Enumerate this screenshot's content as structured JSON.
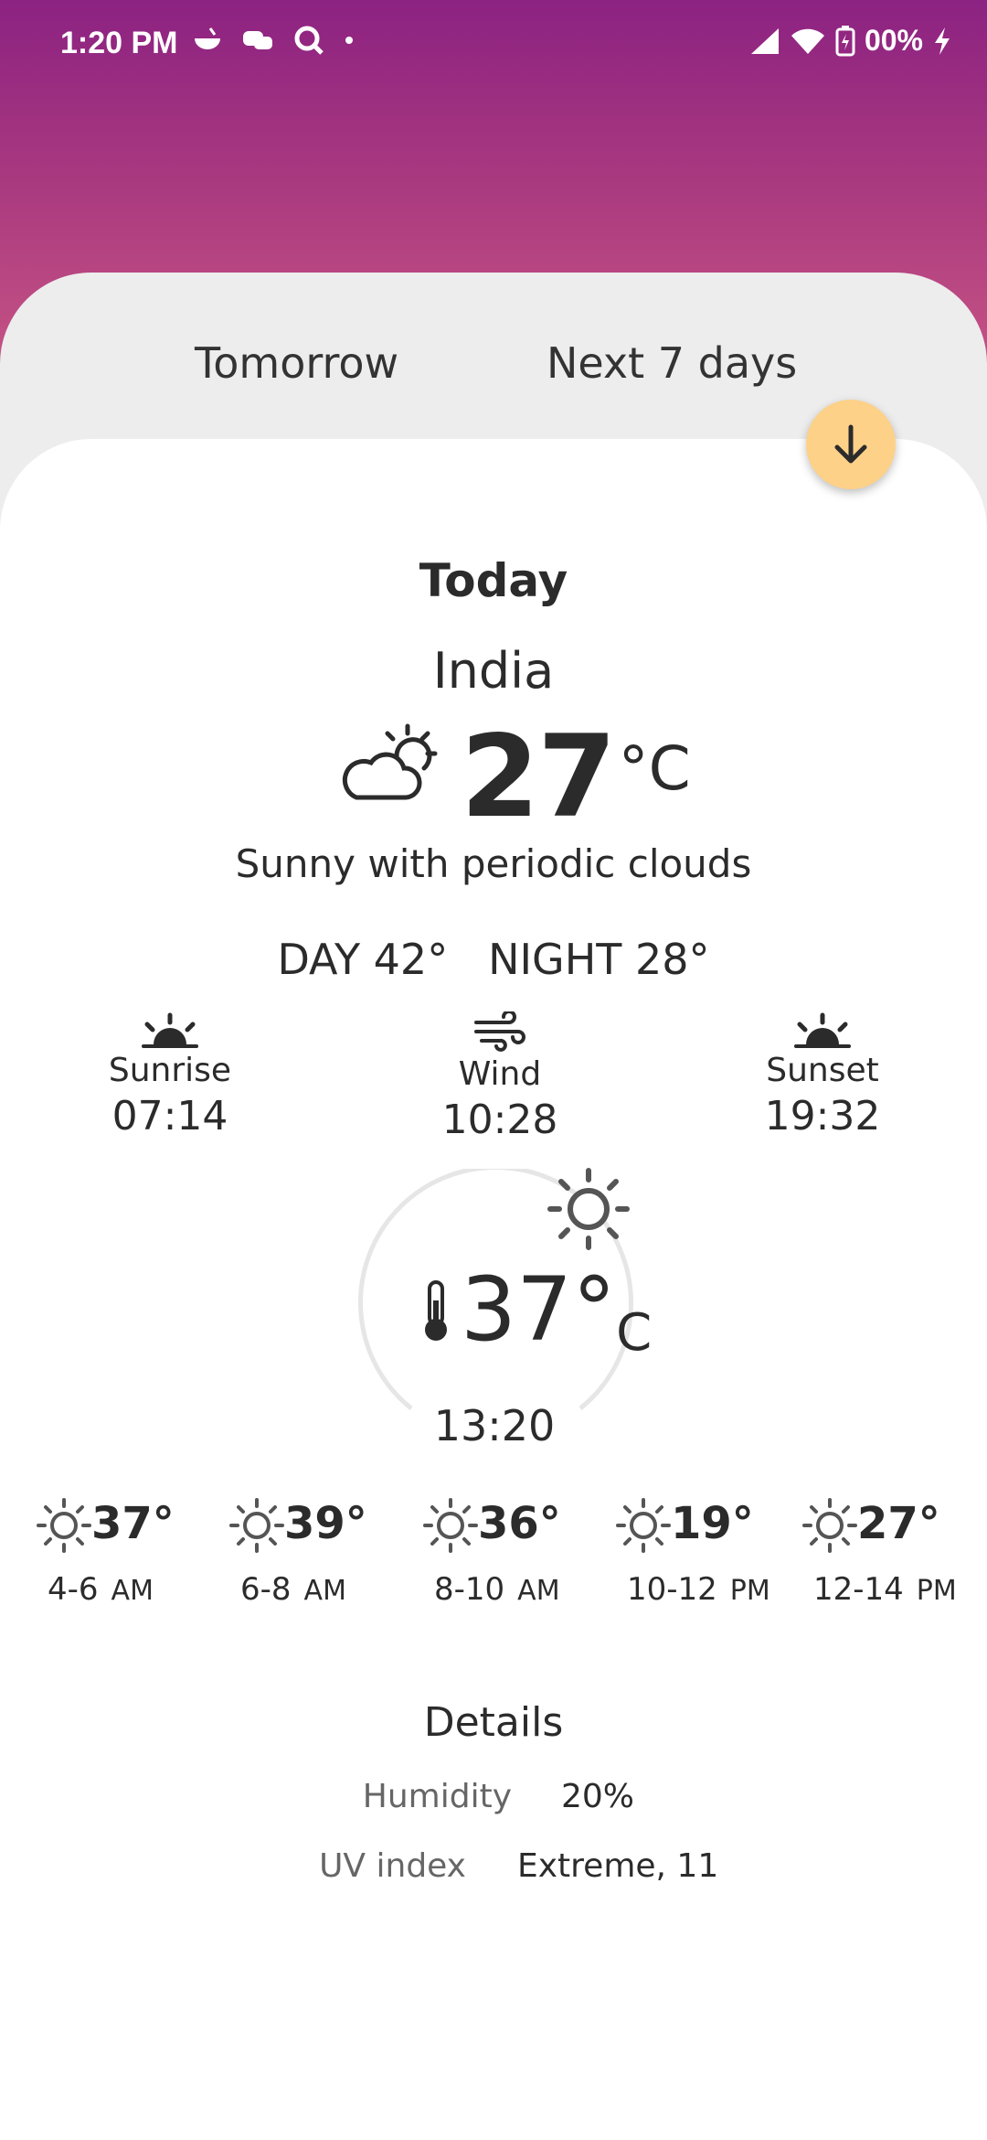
{
  "status_bar": {
    "time": "1:20 PM",
    "battery": "00%"
  },
  "tabs": [
    {
      "label": "Tomorrow"
    },
    {
      "label": "Next 7 days"
    }
  ],
  "today": {
    "title": "Today",
    "location": "India",
    "temperature": "27",
    "unit": "°C",
    "condition": "Sunny with periodic clouds",
    "day_night": "DAY 42°   NIGHT 28°"
  },
  "info": {
    "sunrise": {
      "label": "Sunrise",
      "value": "07:14"
    },
    "wind": {
      "label": "Wind",
      "value": "10:28"
    },
    "sunset": {
      "label": "Sunset",
      "value": "19:32"
    }
  },
  "current": {
    "temperature": "37°",
    "unit": "C",
    "time": "13:20"
  },
  "hourly": [
    {
      "temp": "37°",
      "range": "4-6",
      "ampm": "AM"
    },
    {
      "temp": "39°",
      "range": "6-8",
      "ampm": "AM"
    },
    {
      "temp": "36°",
      "range": "8-10",
      "ampm": "AM"
    },
    {
      "temp": "19°",
      "range": "10-12",
      "ampm": "PM"
    },
    {
      "temp": "27°",
      "range": "12-14",
      "ampm": "PM"
    }
  ],
  "details": {
    "title": "Details",
    "humidity_label": "Humidity",
    "humidity_value": "20%",
    "uv_label": "UV index",
    "uv_value": "Extreme, 11"
  },
  "colors": {
    "accent": "#fdd188",
    "gradient_top": "#8c2282",
    "gradient_bottom": "#c85585"
  }
}
